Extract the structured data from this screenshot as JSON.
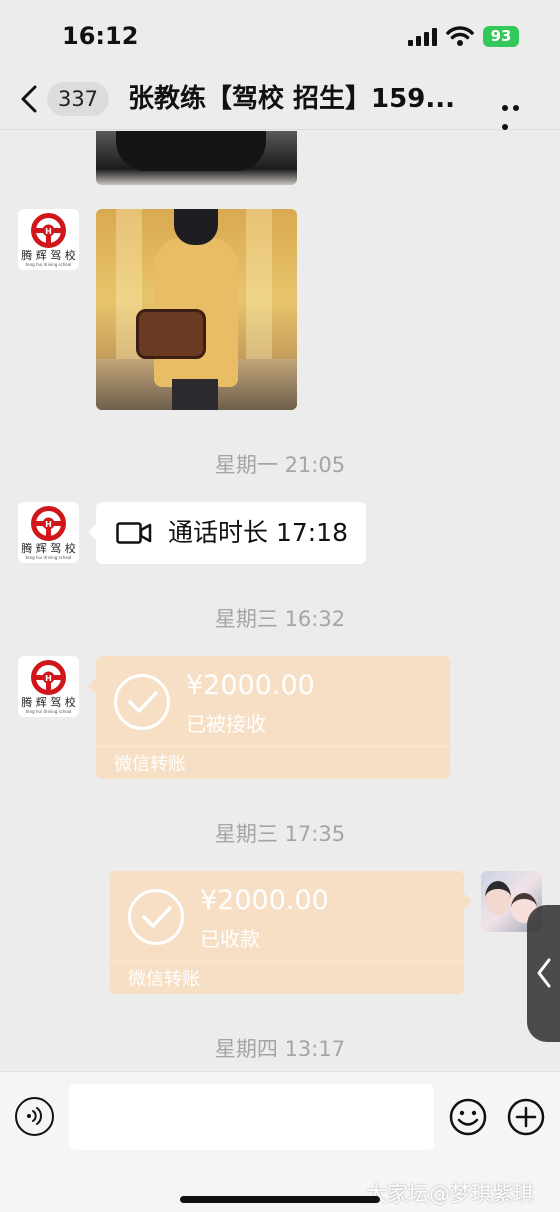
{
  "status_bar": {
    "time": "16:12",
    "battery": "93"
  },
  "nav": {
    "back_count": "337",
    "title": "张教练【驾校 招生】159..."
  },
  "contact_avatar": {
    "logo_text": "腾 辉 驾 校",
    "logo_sub": "teng hui driving school"
  },
  "messages": {
    "ts1": "星期一 21:05",
    "call": {
      "text": "通话时长 17:18"
    },
    "ts2": "星期三 16:32",
    "transfer1": {
      "amount": "¥2000.00",
      "status": "已被接收",
      "footer": "微信转账"
    },
    "ts3": "星期三 17:35",
    "transfer2": {
      "amount": "¥2000.00",
      "status": "已收款",
      "footer": "微信转账"
    },
    "ts4": "星期四 13:17"
  },
  "input": {
    "placeholder": ""
  },
  "watermark": "大家坛@梦琪紫琪",
  "colors": {
    "transfer_bg": "#f6dfc4",
    "battery": "#34c759",
    "background": "#ececec"
  }
}
